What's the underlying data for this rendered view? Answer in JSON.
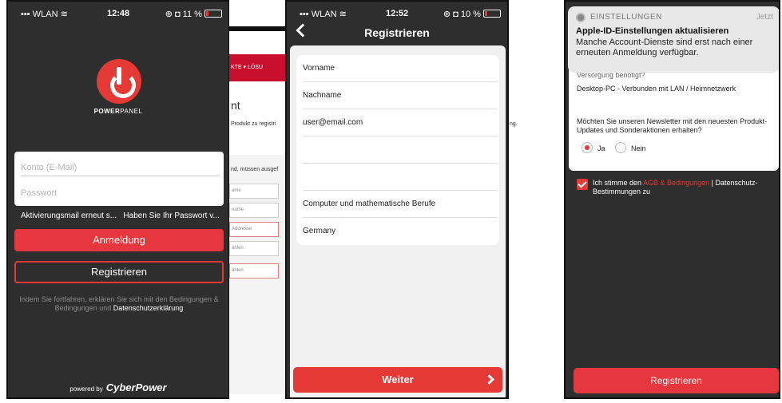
{
  "phone1": {
    "status": {
      "carrier": "WLAN",
      "time": "12:48",
      "battery": "11 %"
    },
    "brand_a": "POWER",
    "brand_b": "PANEL",
    "account_placeholder": "Konto (E-Mail)",
    "password_placeholder": "Passwort",
    "activation_link": "Aktivierungsmail erneut s...",
    "forgot_link": "Haben Sie Ihr Passwort v...",
    "login_label": "Anmeldung",
    "register_label": "Registrieren",
    "legal_text": "Indem Sie fortfahren, erklären Sie sich mit den Bedingungen & Bedingungen und",
    "privacy_link": "Datenschutzerklärung",
    "powered_by": "powered by",
    "powered_brand": "CyberPower"
  },
  "web": {
    "nav": "KTE ▾   LÖSU",
    "title": "nt",
    "subtitle": "Produkt zu registri",
    "trailing": "ng.",
    "required": "nd, müssen ausgef",
    "fields": [
      "ame",
      "name",
      "Addresse",
      "ählen",
      "ählen"
    ]
  },
  "phone2": {
    "status": {
      "carrier": "WLAN",
      "time": "12:52",
      "battery": "10 %"
    },
    "title": "Registrieren",
    "fields": [
      "Vorname",
      "Nachname",
      "user@email.com",
      "",
      "",
      "Computer und mathematische Berufe",
      "Germany"
    ],
    "next_label": "Weiter"
  },
  "phone3": {
    "notification": {
      "app": "EINSTELLUNGEN",
      "time": "Jetzt",
      "title": "Apple-ID-Einstellungen aktualisieren",
      "body": "Manche Account-Dienste sind erst nach einer erneuten Anmeldung verfügbar."
    },
    "partial_label": "Versorgung benötigt?",
    "device": "Desktop-PC - Verbunden mit LAN / Heimnetzwerk",
    "newsletter_q": "Möchten Sie unseren Newsletter mit den neuesten Produkt-Updates und Sonderaktionen erhalten?",
    "yes": "Ja",
    "no": "Nein",
    "agree_a": "Ich stimme den",
    "agree_link": "AGB & Bedingungen",
    "agree_b": "| Datenschutz-Bestimmungen zu",
    "register_label": "Registrieren"
  },
  "colors": {
    "accent": "#e53935",
    "dark_bg": "#2e2e2e"
  }
}
